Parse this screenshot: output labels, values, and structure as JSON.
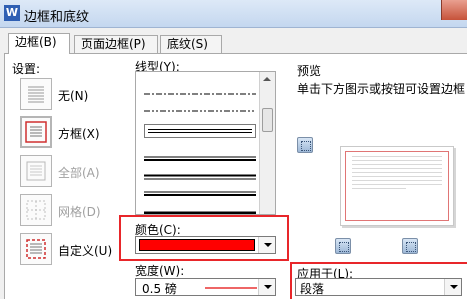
{
  "window": {
    "title": "边框和底纹",
    "app_icon_letter": "W"
  },
  "tabs": [
    {
      "label": "边框(B)",
      "active": true
    },
    {
      "label": "页面边框(P)",
      "active": false
    },
    {
      "label": "底纹(S)",
      "active": false
    }
  ],
  "settings": {
    "label": "设置:",
    "items": [
      {
        "label": "无(N)",
        "icon": "no-border-icon",
        "enabled": true,
        "selected": false
      },
      {
        "label": "方框(X)",
        "icon": "box-border-icon",
        "enabled": true,
        "selected": true
      },
      {
        "label": "全部(A)",
        "icon": "all-borders-icon",
        "enabled": false,
        "selected": false
      },
      {
        "label": "网格(D)",
        "icon": "grid-borders-icon",
        "enabled": false,
        "selected": false
      },
      {
        "label": "自定义(U)",
        "icon": "custom-border-icon",
        "enabled": true,
        "selected": false
      }
    ]
  },
  "line_style": {
    "label": "线型(Y):"
  },
  "color": {
    "label": "颜色(C):",
    "value": "#ff0000",
    "highlight": "#e8262a"
  },
  "width": {
    "label": "宽度(W):",
    "value": "0.5 磅"
  },
  "preview": {
    "label": "预览",
    "hint": "单击下方图示或按钮可设置边框"
  },
  "apply_to": {
    "label": "应用于(L):",
    "value": "段落"
  }
}
